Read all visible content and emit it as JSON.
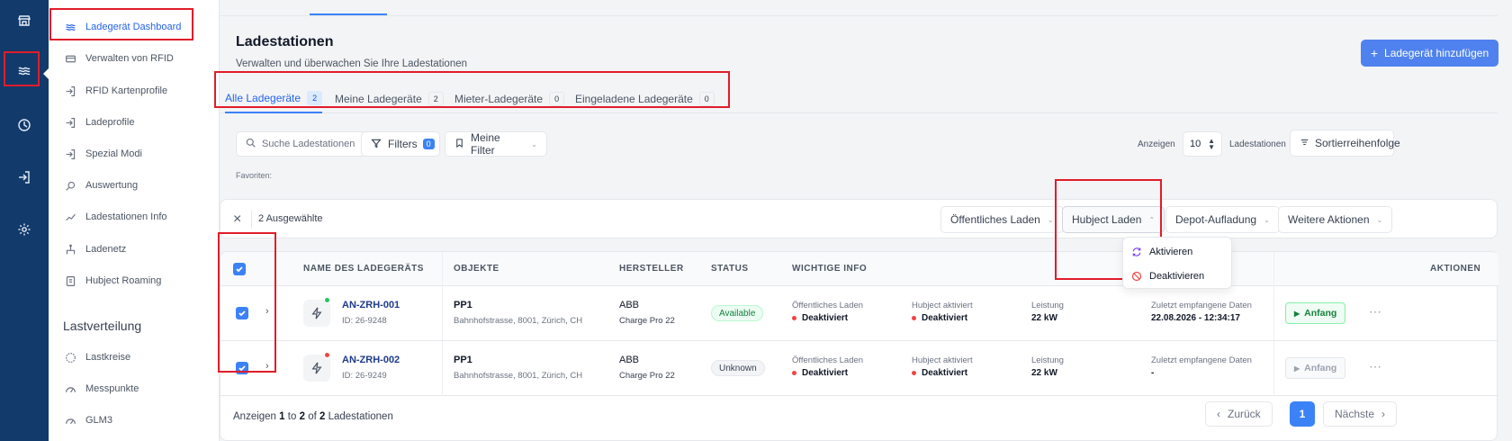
{
  "rail": {
    "icons": [
      "store-icon",
      "waves-icon",
      "clock-icon",
      "login-icon",
      "gear-icon"
    ]
  },
  "sidebar": {
    "items": [
      {
        "label": "Ladegerät Dashboard",
        "icon": "waves-icon"
      },
      {
        "label": "Verwalten von RFID",
        "icon": "card-icon"
      },
      {
        "label": "RFID Kartenprofile",
        "icon": "login-icon"
      },
      {
        "label": "Ladeprofile",
        "icon": "login-icon"
      },
      {
        "label": "Spezial Modi",
        "icon": "login-icon"
      },
      {
        "label": "Auswertung",
        "icon": "search-icon"
      },
      {
        "label": "Ladestationen Info",
        "icon": "trend-icon"
      },
      {
        "label": "Ladenetz",
        "icon": "network-icon"
      },
      {
        "label": "Hubject Roaming",
        "icon": "document-icon"
      }
    ],
    "section2_title": "Lastverteilung",
    "section2_items": [
      {
        "label": "Lastkreise",
        "icon": "circle-icon"
      },
      {
        "label": "Messpunkte",
        "icon": "gauge-icon"
      },
      {
        "label": "GLM3",
        "icon": "gauge-icon"
      }
    ]
  },
  "header": {
    "title": "Ladestationen",
    "subtitle": "Verwalten und überwachen Sie Ihre Ladestationen",
    "add_button": "Ladegerät hinzufügen"
  },
  "tabs": [
    {
      "label": "Alle Ladegeräte",
      "count": "2"
    },
    {
      "label": "Meine Ladegeräte",
      "count": "2"
    },
    {
      "label": "Mieter-Ladegeräte",
      "count": "0"
    },
    {
      "label": "Eingeladene Ladegeräte",
      "count": "0"
    }
  ],
  "toolbar": {
    "search_placeholder": "Suche Ladestationen",
    "filters_label": "Filters",
    "filters_count": "0",
    "my_filter_label": "Meine Filter",
    "show_label": "Anzeigen",
    "page_size": "10",
    "stations_label": "Ladestationen",
    "sort_label": "Sortierreihenfolge",
    "favorites_label": "Favoriten:"
  },
  "bulk": {
    "selected_text": "2 Ausgewählte",
    "public_charging": "Öffentliches Laden",
    "hubject_charging": "Hubject Laden",
    "depot_charging": "Depot-Aufladung",
    "more_actions": "Weitere Aktionen",
    "menu": {
      "activate": "Aktivieren",
      "deactivate": "Deaktivieren"
    }
  },
  "table": {
    "columns": [
      "NAME DES LADEGERÄTS",
      "OBJEKTE",
      "HERSTELLER",
      "STATUS",
      "WICHTIGE INFO",
      "AKTIONEN"
    ],
    "rows": [
      {
        "name": "AN-ZRH-001",
        "id": "ID: 26-9248",
        "object": "PP1",
        "address": "Bahnhofstrasse, 8001, Zürich, CH",
        "maker": "ABB",
        "model": "Charge Pro 22",
        "status": "Available",
        "info1_label": "Öffentliches Laden",
        "info1_value": "Deaktiviert",
        "info2_label": "Hubject aktiviert",
        "info2_value": "Deaktiviert",
        "info3_label": "Leistung",
        "info3_value": "22 kW",
        "info4_label": "Zuletzt empfangene Daten",
        "info4_value": "22.08.2026 - 12:34:17",
        "action": "Anfang",
        "online_color": "#22c55e"
      },
      {
        "name": "AN-ZRH-002",
        "id": "ID: 26-9249",
        "object": "PP1",
        "address": "Bahnhofstrasse, 8001, Zürich, CH",
        "maker": "ABB",
        "model": "Charge Pro 22",
        "status": "Unknown",
        "info1_label": "Öffentliches Laden",
        "info1_value": "Deaktiviert",
        "info2_label": "Hubject aktiviert",
        "info2_value": "Deaktiviert",
        "info3_label": "Leistung",
        "info3_value": "22 kW",
        "info4_label": "Zuletzt empfangene Daten",
        "info4_value": "-",
        "action": "Anfang",
        "online_color": "#ef4444"
      }
    ]
  },
  "footer": {
    "showing": "Anzeigen",
    "from": "1",
    "to_word": "to",
    "to": "2",
    "of_word": "of",
    "total": "2",
    "unit": "Ladestationen",
    "prev": "Zurück",
    "page": "1",
    "next": "Nächste"
  },
  "colors": {
    "accent": "#3b82f6",
    "rail": "#123a6b",
    "highlight": "#e11d2a"
  }
}
